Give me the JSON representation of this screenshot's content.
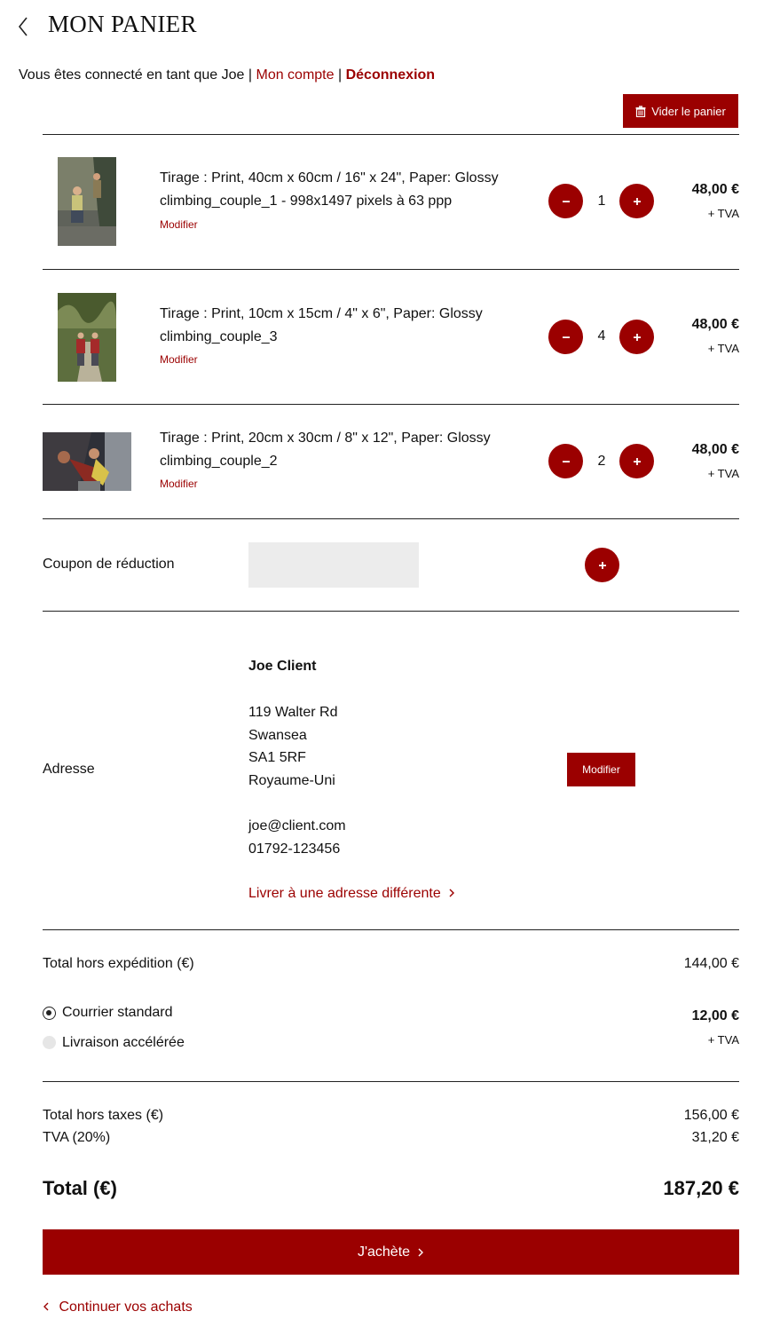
{
  "header": {
    "title": "MON PANIER",
    "login_prefix": "Vous êtes connecté en tant que Joe",
    "separator": "|",
    "my_account": "Mon compte",
    "logout": "Déconnexion"
  },
  "cart": {
    "empty_label": "Vider le panier",
    "edit_label": "Modifier",
    "tva_label": "+ TVA",
    "items": [
      {
        "line1": "Tirage : Print, 40cm x 60cm / 16\" x 24\", Paper: Glossy",
        "line2": "climbing_couple_1 - 998x1497 pixels à 63 ppp",
        "qty": "1",
        "price": "48,00 €"
      },
      {
        "line1": "Tirage : Print, 10cm x 15cm / 4\" x 6\", Paper: Glossy",
        "line2": "climbing_couple_3",
        "qty": "4",
        "price": "48,00 €"
      },
      {
        "line1": "Tirage : Print, 20cm x 30cm / 8\" x 12\", Paper: Glossy",
        "line2": "climbing_couple_2",
        "qty": "2",
        "price": "48,00 €"
      }
    ]
  },
  "coupon": {
    "label": "Coupon de réduction",
    "value": ""
  },
  "address": {
    "label": "Adresse",
    "name": "Joe Client",
    "street": "119 Walter Rd",
    "city": "Swansea",
    "postcode": "SA1 5RF",
    "country": "Royaume-Uni",
    "email": "joe@client.com",
    "phone": "01792-123456",
    "edit_label": "Modifier",
    "ship_different": "Livrer à une adresse différente"
  },
  "shipping": {
    "subtotal_label": "Total hors expédition (€)",
    "subtotal_value": "144,00 €",
    "options": [
      {
        "label": "Courrier standard",
        "selected": true
      },
      {
        "label": "Livraison accélérée",
        "selected": false
      }
    ],
    "price": "12,00 €",
    "tva_label": "+ TVA"
  },
  "totals": {
    "ht_label": "Total hors taxes (€)",
    "ht_value": "156,00 €",
    "tva_label": "TVA (20%)",
    "tva_value": "31,20 €",
    "total_label": "Total (€)",
    "total_value": "187,20 €"
  },
  "actions": {
    "buy_label": "J'achète",
    "continue_label": "Continuer vos achats"
  },
  "colors": {
    "accent": "#9b0000",
    "coupon_bg": "#ececec"
  }
}
